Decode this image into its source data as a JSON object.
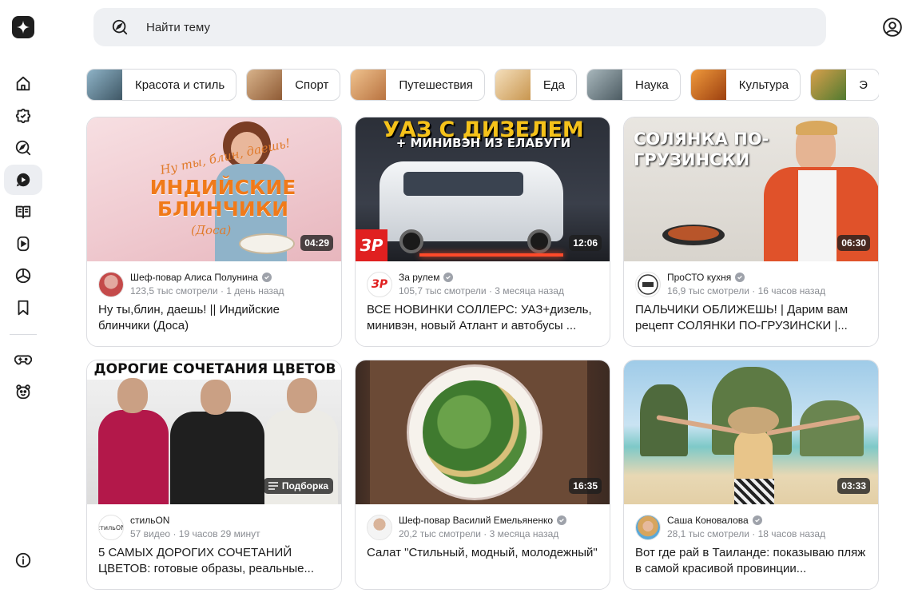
{
  "search": {
    "placeholder": "Найти тему",
    "icon": "compass-search-icon"
  },
  "sidebar": {
    "items": [
      {
        "name": "home-icon",
        "active": false
      },
      {
        "name": "puzzle-icon",
        "active": false
      },
      {
        "name": "explore-icon",
        "active": false
      },
      {
        "name": "video-icon",
        "active": true
      },
      {
        "name": "articles-icon",
        "active": false
      },
      {
        "name": "shorts-icon",
        "active": false
      },
      {
        "name": "cube-icon",
        "active": false
      },
      {
        "name": "bookmark-icon",
        "active": false
      },
      {
        "name": "gamepad-icon",
        "active": false
      },
      {
        "name": "kids-icon",
        "active": false
      },
      {
        "name": "info-icon",
        "active": false
      }
    ]
  },
  "chips": [
    {
      "label": "Красота и стиль",
      "color": "#5d7a8a"
    },
    {
      "label": "Спорт",
      "color": "#c98a56"
    },
    {
      "label": "Путешествия",
      "color": "#d9a074"
    },
    {
      "label": "Еда",
      "color": "#e6c497"
    },
    {
      "label": "Наука",
      "color": "#7c8e96"
    },
    {
      "label": "Культура",
      "color": "#d46c1f"
    },
    {
      "label": "Э",
      "color": "#6c8a3a"
    }
  ],
  "cards": [
    {
      "overlay_script": "Ну ты, блин, даешь!",
      "overlay_main": "ИНДИЙСКИЕ БЛИНЧИКИ",
      "overlay_sub": "(Доса)",
      "duration": "04:29",
      "channel": "Шеф-повар Алиса Полунина",
      "stats": "123,5 тыс смотрели · 1 день назад",
      "title": "Ну ты,блин, даешь! || Индийские блинчики (Доса)"
    },
    {
      "overlay_main": "УАЗ С ДИЗЕЛЕМ",
      "overlay_sub": "+ МИНИВЭН ИЗ ЕЛАБУГИ",
      "overlay_logo": "ЗР",
      "duration": "12:06",
      "channel": "За рулем",
      "stats": "105,7 тыс смотрели · 3 месяца назад",
      "title": "ВСЕ НОВИНКИ СОЛЛЕРС: УАЗ+дизель, минивэн, новый Атлант и автобусы ..."
    },
    {
      "overlay_main": "СОЛЯНКА ПО-ГРУЗИНСКИ",
      "duration": "06:30",
      "channel": "ПроСТО кухня",
      "stats": "16,9 тыс смотрели · 16 часов назад",
      "title": "ПАЛЬЧИКИ ОБЛИЖЕШЬ! | Дарим вам рецепт СОЛЯНКИ ПО-ГРУЗИНСКИ |..."
    },
    {
      "overlay_main": "ДОРОГИЕ СОЧЕТАНИЯ ЦВЕТОВ",
      "badge": "Подборка",
      "channel": "стильON",
      "stats": "57 видео · 19 часов 29 минут",
      "title": "5 САМЫХ ДОРОГИХ СОЧЕТАНИЙ ЦВЕТОВ: готовые образы, реальные..."
    },
    {
      "duration": "16:35",
      "channel": "Шеф-повар Василий Емельяненко",
      "stats": "20,2 тыс смотрели · 3 месяца назад",
      "title": "Салат \"Стильный, модный, молодежный\""
    },
    {
      "duration": "03:33",
      "channel": "Саша Коновалова",
      "stats": "28,1 тыс смотрели · 18 часов назад",
      "title": "Вот где рай в Таиланде: показываю пляж в самой красивой провинции..."
    }
  ]
}
